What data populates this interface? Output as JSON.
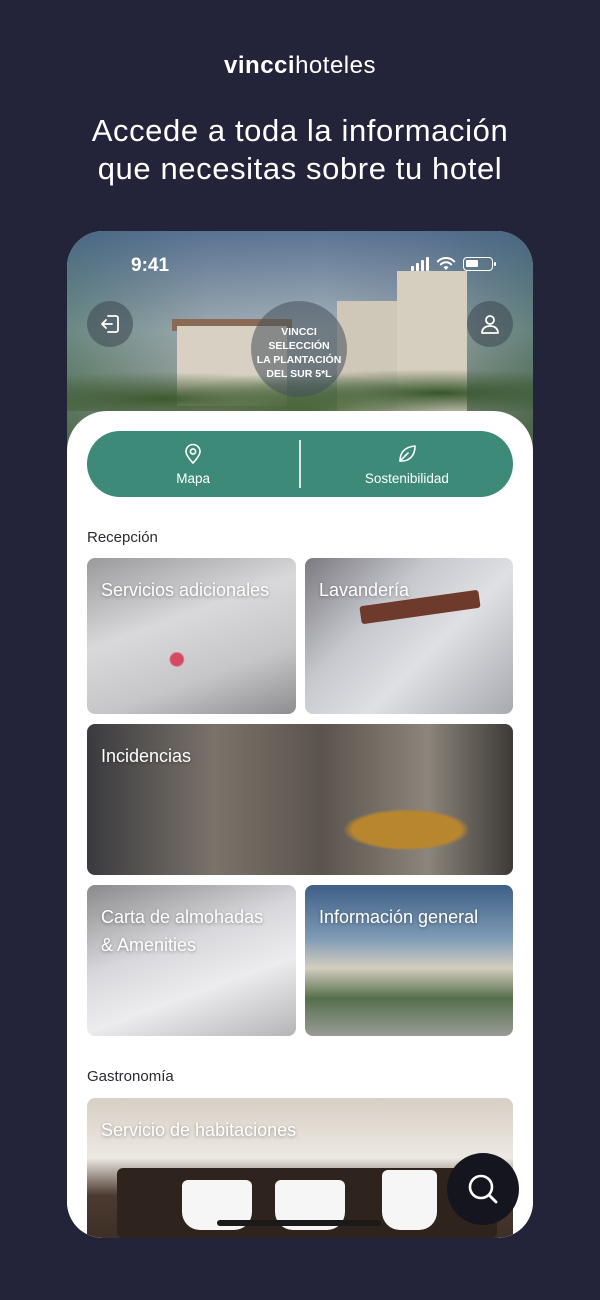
{
  "brand": {
    "bold": "vincci",
    "light": "hoteles"
  },
  "headline": "Accede a toda la información\nque necesitas sobre tu hotel",
  "status": {
    "time": "9:41"
  },
  "hotel": {
    "name": "VINCCI\nSELECCIÓN\nLA PLANTACIÓN\nDEL SUR 5*L"
  },
  "quick_actions": [
    {
      "label": "Mapa",
      "icon": "map-pin-icon"
    },
    {
      "label": "Sostenibilidad",
      "icon": "leaf-icon"
    }
  ],
  "sections": [
    {
      "title": "Recepción",
      "cards": [
        {
          "title": "Servicios adicionales"
        },
        {
          "title": "Lavandería"
        },
        {
          "title": "Incidencias"
        },
        {
          "title": "Carta de almohadas\n& Amenities"
        },
        {
          "title": "Información general"
        }
      ]
    },
    {
      "title": "Gastronomía",
      "cards": [
        {
          "title": "Servicio de habitaciones"
        }
      ]
    }
  ],
  "colors": {
    "background": "#23233a",
    "accent": "#3d8a78",
    "fab": "#151520"
  }
}
